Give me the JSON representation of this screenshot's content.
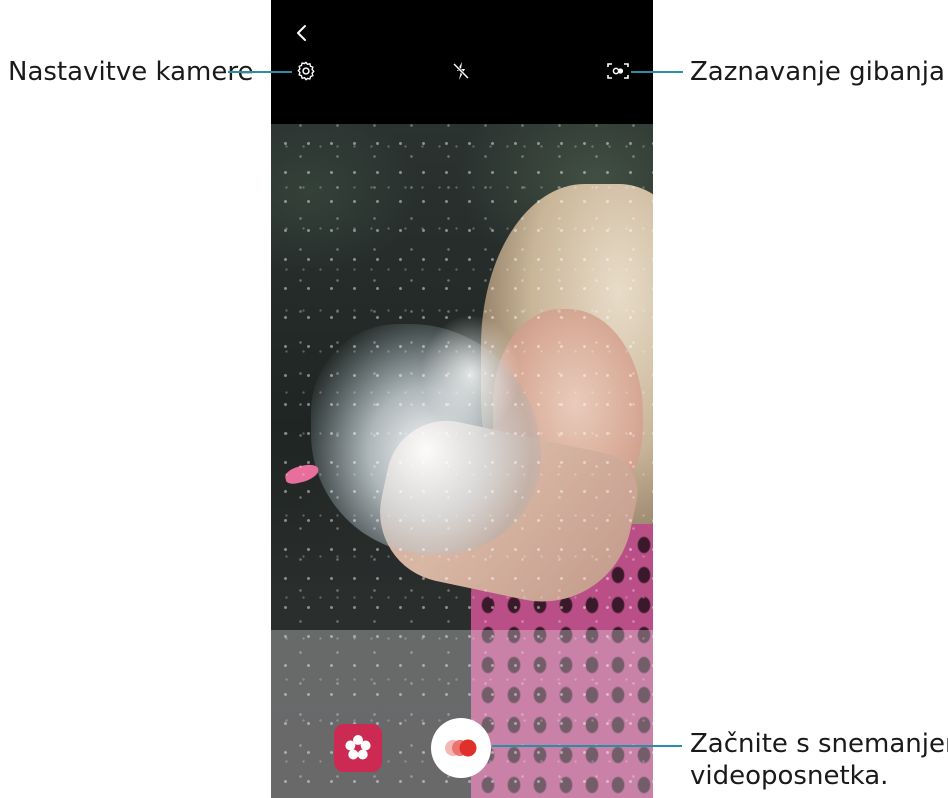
{
  "callouts": {
    "settings": "Nastavitve kamere",
    "motion_detection": "Zaznavanje gibanja",
    "record_line1": "Začnite s snemanjem",
    "record_line2": "videoposnetka."
  },
  "icons": {
    "back": "chevron-left-icon",
    "settings": "gear-icon",
    "flash": "flash-off-icon",
    "motion": "motion-detection-icon",
    "mode": "flower-icon",
    "record": "record-icon"
  },
  "colors": {
    "callout_line": "#2a8fa6",
    "mode_button": "#cc2a52",
    "record_dot": "#e0302c"
  }
}
